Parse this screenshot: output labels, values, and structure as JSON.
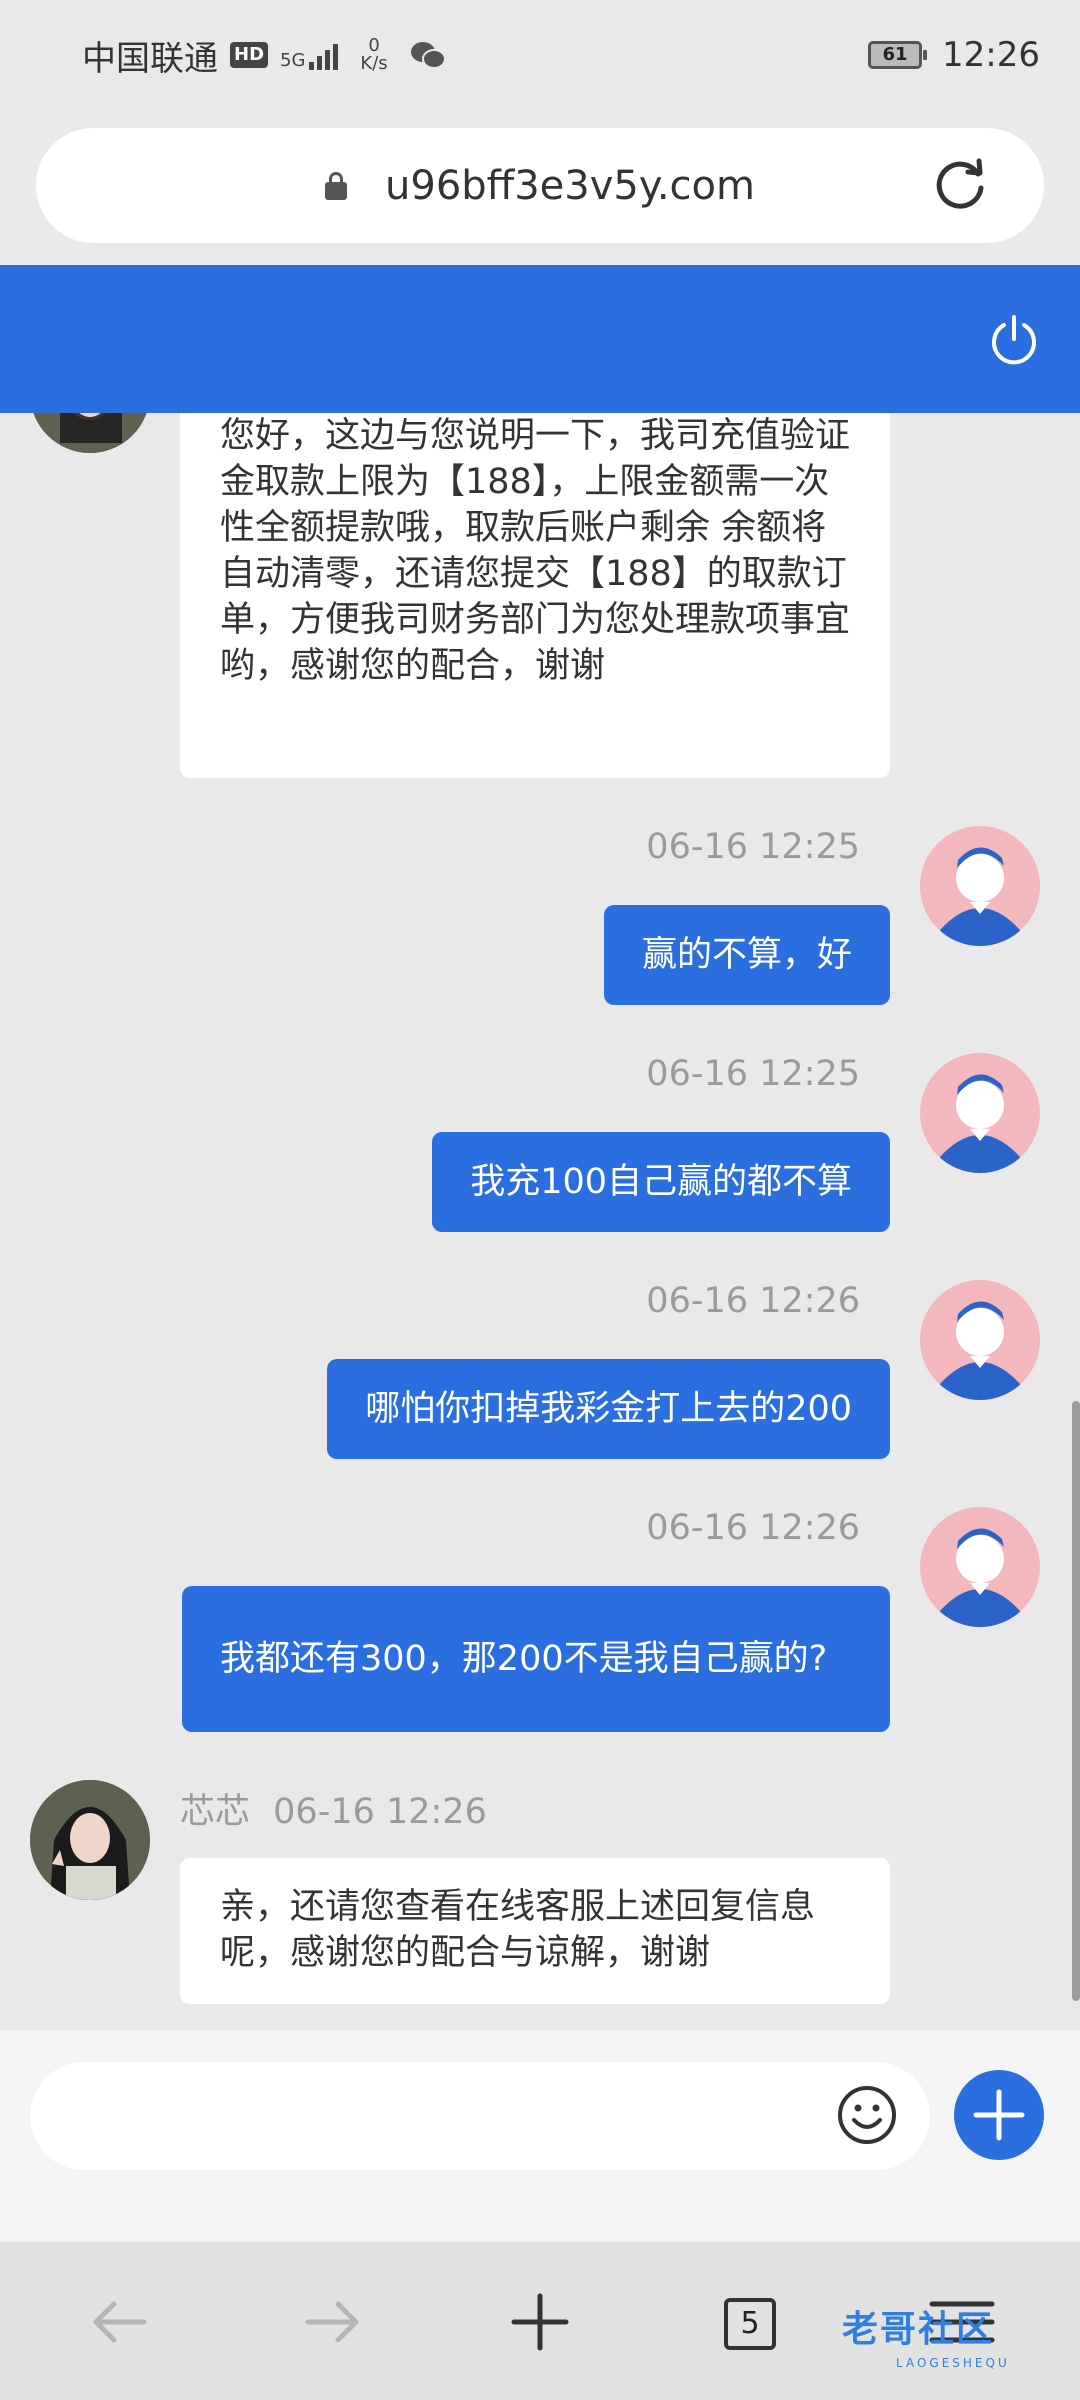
{
  "status_bar": {
    "carrier": "中国联通",
    "hd": "HD",
    "network": "5G",
    "speed_value": "0",
    "speed_unit": "K/s",
    "battery": "61",
    "time": "12:26"
  },
  "browser": {
    "url": "u96bff3e3v5y.com",
    "tabs_count": "5"
  },
  "messages": [
    {
      "side": "in",
      "text": "您好，这边与您说明一下，我司充值验证金取款上限为【188】，上限金额需一次性全额提款哦，取款后账户剩余 余额将自动清零，还请您提交【188】的取款订单，方便我司财务部门为您处理款项事宜哟，感谢您的配合，谢谢"
    },
    {
      "side": "out",
      "time": "06-16 12:25",
      "text": "赢的不算，好"
    },
    {
      "side": "out",
      "time": "06-16 12:25",
      "text": "我充100自己赢的都不算"
    },
    {
      "side": "out",
      "time": "06-16 12:26",
      "text": "哪怕你扣掉我彩金打上去的200"
    },
    {
      "side": "out",
      "time": "06-16 12:26",
      "text": "我都还有300，那200不是我自己赢的?"
    },
    {
      "side": "in",
      "name": "芯芯",
      "time": "06-16 12:26",
      "text": "亲，还请您查看在线客服上述回复信息呢，感谢您的配合与谅解，谢谢"
    }
  ],
  "composer": {
    "placeholder": ""
  },
  "watermark": {
    "main": "老哥社区",
    "sub": "LAOGESHEQU"
  },
  "colors": {
    "primary": "#2b6ee0",
    "background": "#e9e9e9",
    "user_avatar_bg": "#f3b8bd"
  },
  "icons": [
    "lock-icon",
    "reload-icon",
    "power-icon",
    "emoji-icon",
    "plus-icon",
    "back-icon",
    "forward-icon",
    "new-tab-icon",
    "menu-icon"
  ]
}
